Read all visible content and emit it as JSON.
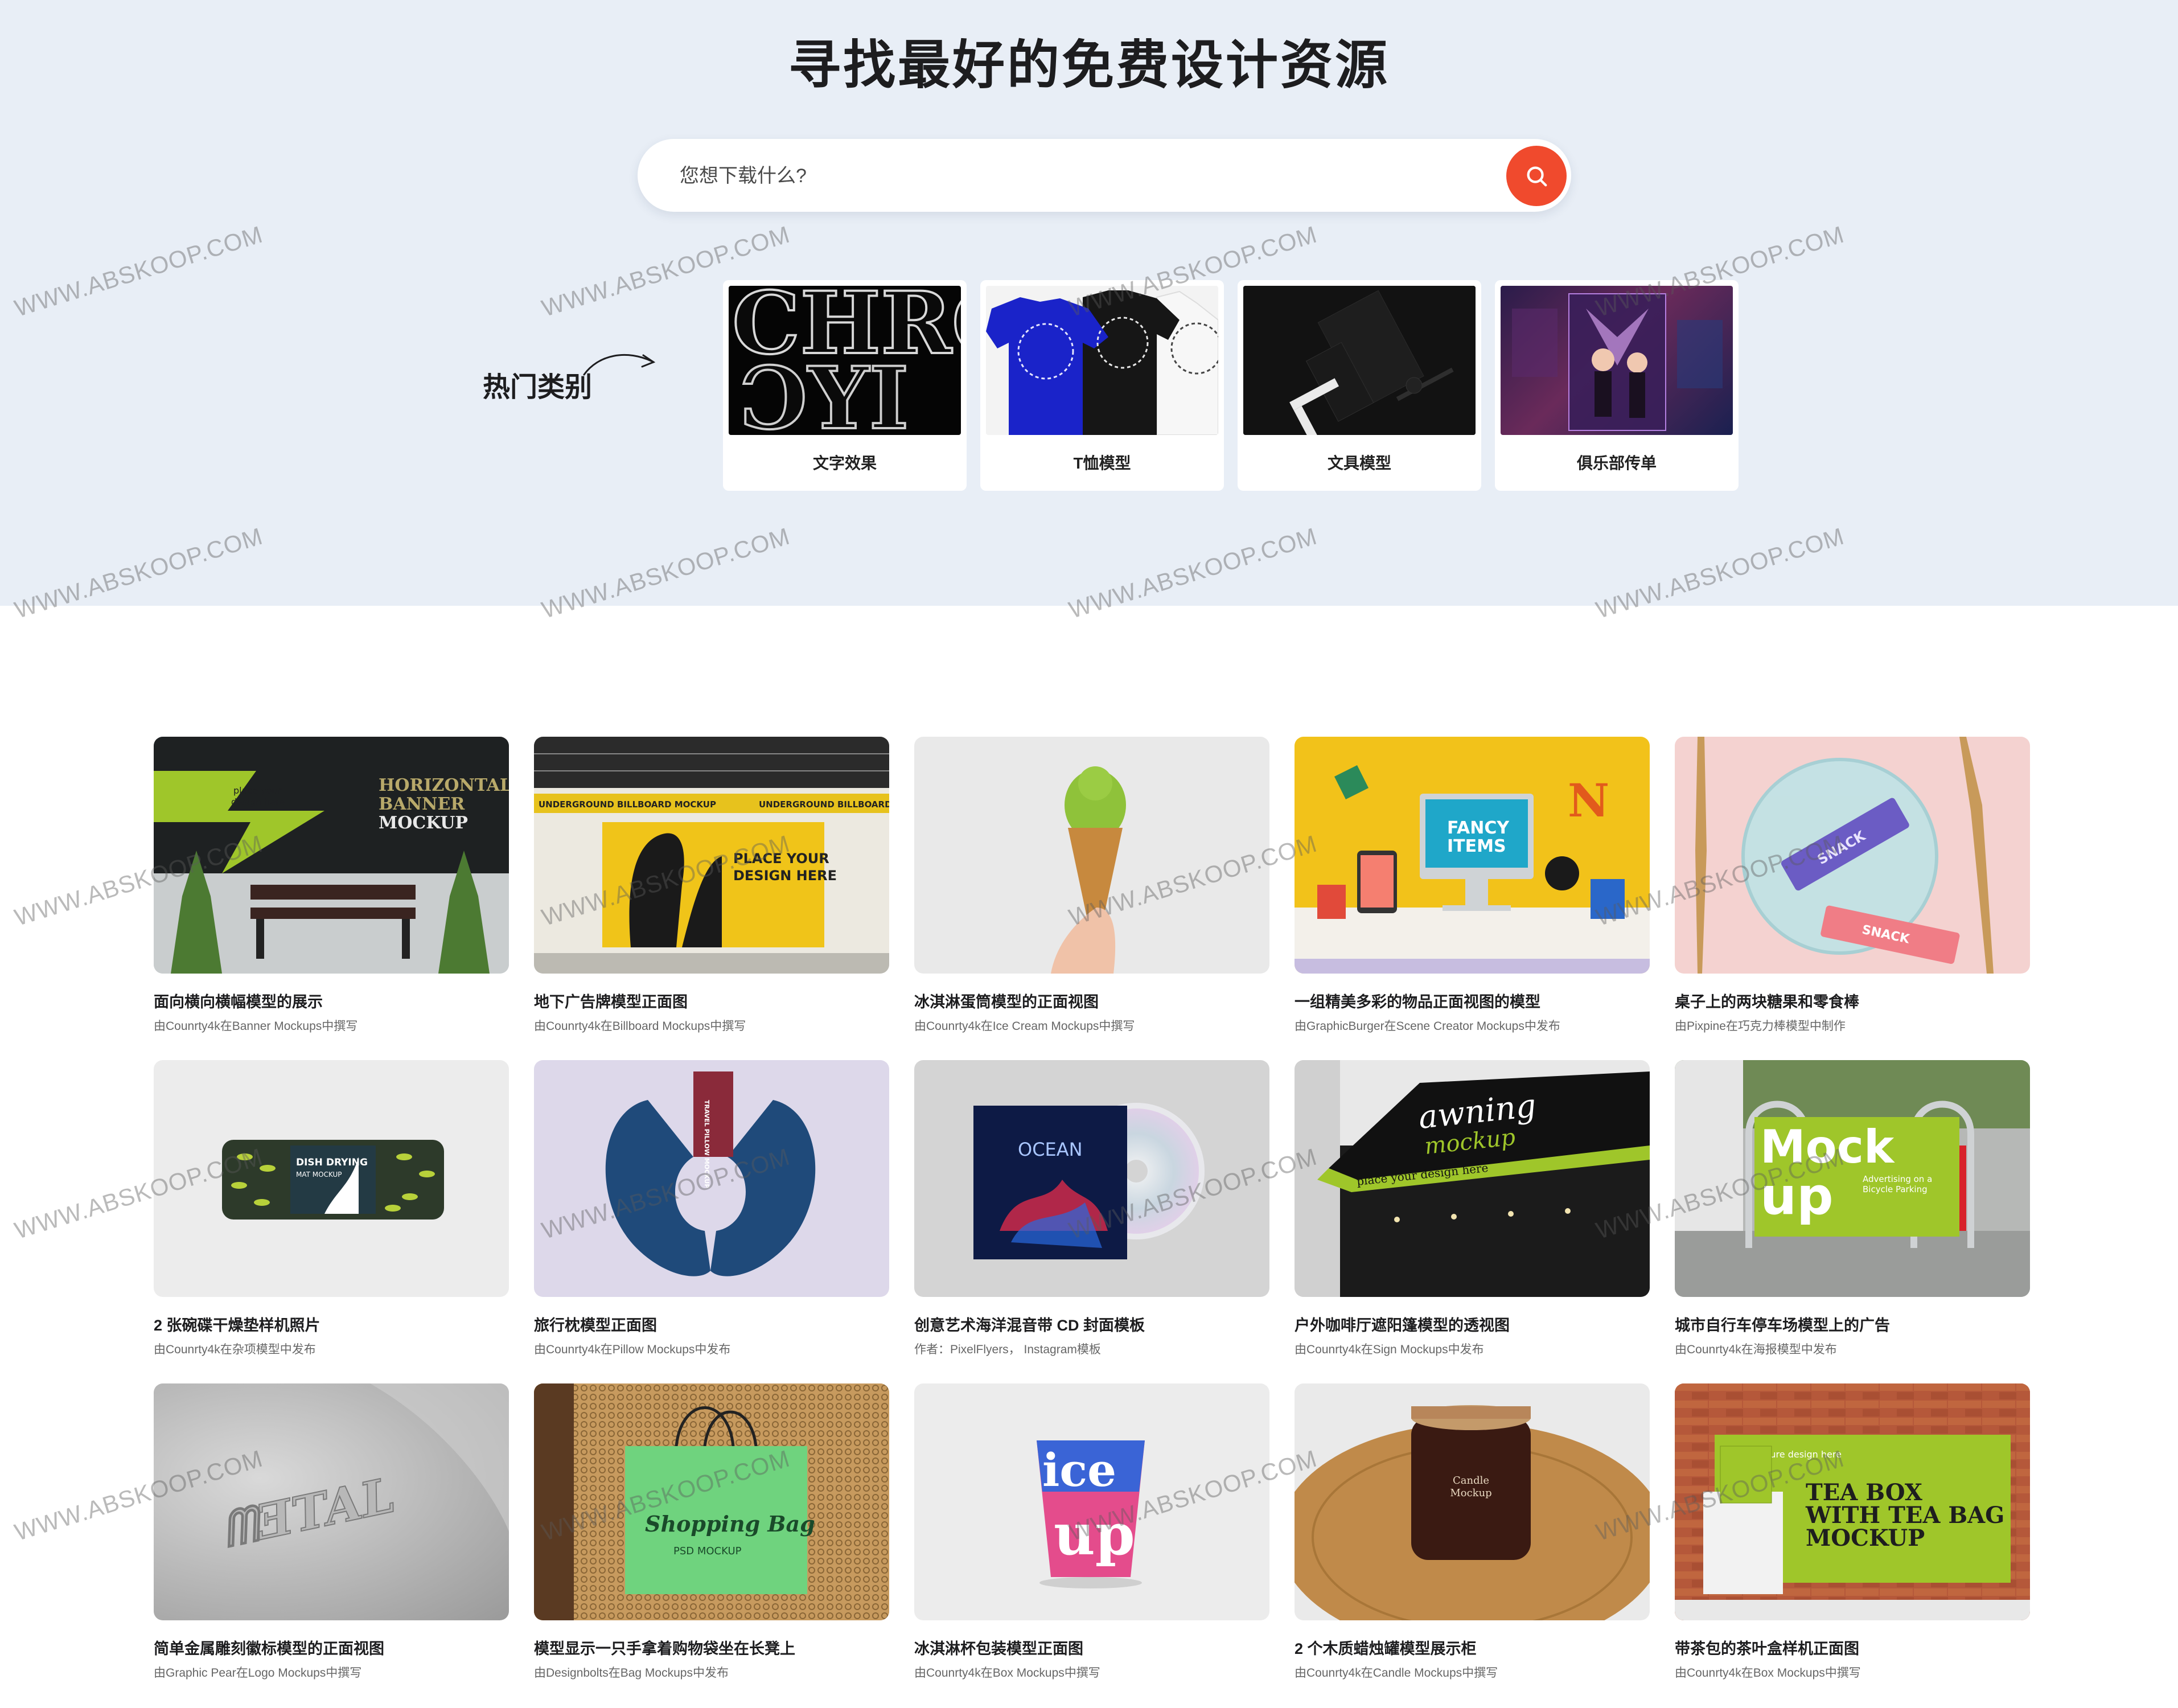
{
  "hero": {
    "title": "寻找最好的免费设计资源",
    "search": {
      "placeholder": "您想下载什么?"
    },
    "popular_label": "热门类别",
    "categories": [
      {
        "label": "文字效果"
      },
      {
        "label": "T恤模型"
      },
      {
        "label": "文具模型"
      },
      {
        "label": "俱乐部传单"
      }
    ]
  },
  "cards": [
    {
      "title": "面向横向横幅模型的展示",
      "sub": "由Counrty4k在Banner Mockups中撰写"
    },
    {
      "title": "地下广告牌模型正面图",
      "sub": "由Counrty4k在Billboard Mockups中撰写"
    },
    {
      "title": "冰淇淋蛋筒模型的正面视图",
      "sub": "由Counrty4k在Ice Cream Mockups中撰写"
    },
    {
      "title": "一组精美多彩的物品正面视图的模型",
      "sub": "由GraphicBurger在Scene Creator Mockups中发布"
    },
    {
      "title": "桌子上的两块糖果和零食棒",
      "sub": "由Pixpine在巧克力棒模型中制作"
    },
    {
      "title": "2 张碗碟干燥垫样机照片",
      "sub": "由Counrty4k在杂项模型中发布"
    },
    {
      "title": "旅行枕模型正面图",
      "sub": "由Counrty4k在Pillow Mockups中发布"
    },
    {
      "title": "创意艺术海洋混音带 CD 封面模板",
      "sub": "作者：PixelFlyers， Instagram模板"
    },
    {
      "title": "户外咖啡厅遮阳篷模型的透视图",
      "sub": "由Counrty4k在Sign Mockups中发布"
    },
    {
      "title": "城市自行车停车场模型上的广告",
      "sub": "由Counrty4k在海报模型中发布"
    },
    {
      "title": "简单金属雕刻徽标模型的正面视图",
      "sub": "由Graphic Pear在Logo Mockups中撰写"
    },
    {
      "title": "模型显示一只手拿着购物袋坐在长凳上",
      "sub": "由Designbolts在Bag Mockups中发布"
    },
    {
      "title": "冰淇淋杯包装模型正面图",
      "sub": "由Counrty4k在Box Mockups中撰写"
    },
    {
      "title": "2 个木质蜡烛罐模型展示柜",
      "sub": "由Counrty4k在Candle Mockups中撰写"
    },
    {
      "title": "带茶包的茶叶盒样机正面图",
      "sub": "由Counrty4k在Box Mockups中撰写"
    }
  ],
  "thumb_text": {
    "chrome": "CHRO",
    "chrome2": "ƆYI",
    "banner1": "HORIZONTAL",
    "banner2": "BANNER",
    "banner3": "MOCKUP",
    "banner_place1": "place your",
    "banner_place2": "design here",
    "billboard_strip": "UNDERGROUND BILLBOARD MOCKUP",
    "billboard_place1": "PLACE YOUR",
    "billboard_place2": "DESIGN HERE",
    "fancy1": "FANCY",
    "fancy2": "ITEMS",
    "snack": "SNACK",
    "dish1": "DISH DRYING",
    "dish2": "MAT MOCKUP",
    "pillow": "TRAVEL PILLOW MOCKUP",
    "ocean": "OCEAN",
    "awning1": "awning",
    "awning2": "mockup",
    "awning3": "place your design here",
    "mock1": "Mock",
    "mock2": "up",
    "mock_side": "Advertising on a Bicycle Parking",
    "metal": "ᗰƎTAL",
    "bag1": "Shopping Bag",
    "bag2": "PSD MOCKUP",
    "icecup1": "ice",
    "icecup2": "up",
    "candle": "Candle Mockup",
    "tea1": "TEA BOX",
    "tea2": "WITH TEA BAG",
    "tea3": "MOCKUP",
    "tea_place": "place youre design here"
  },
  "watermark": "WWW.ABSKOOP.COM",
  "colors": {
    "hero_bg": "#e8eef6",
    "accent": "#f04a2d",
    "lime": "#9fc62a"
  }
}
